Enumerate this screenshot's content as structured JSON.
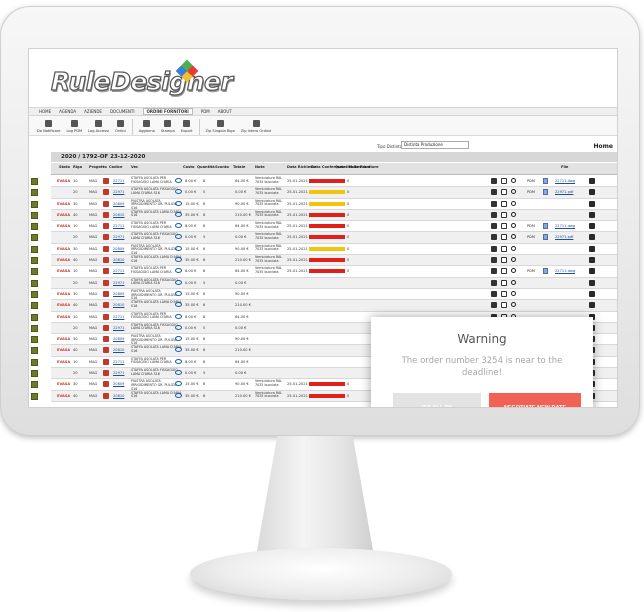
{
  "app": {
    "logo_text": "RuleDesigner",
    "logo_mark": "®"
  },
  "menu": [
    "HOME",
    "AGENDA",
    "AZIENDE",
    "DOCUMENTI",
    "ORDINI FORNITORI",
    "PDM",
    "ABOUT"
  ],
  "menu_active": "ORDINI FORNITORI",
  "toolbar": [
    "Da Notificare",
    "Log PDM",
    "Log Accessi",
    "Ordini",
    "Aggiorna",
    "Stampa",
    "Export",
    "Zip Singola Riga",
    "Zip Intero Ordine"
  ],
  "filter": {
    "label": "Tipo Distinta",
    "value": "Distinta Produzione"
  },
  "home_label": "Home",
  "order_header": "2020  /  1792-OF    23-12-2020",
  "columns": [
    "Stato",
    "Riga",
    "Progetto",
    "Codice",
    "Ver.",
    "Costo",
    "Quantità",
    "Sconto",
    "Totale",
    "Note",
    "Data Richiesta",
    "Data Confermata",
    "Quantità Residua",
    "Note Fornitore",
    "File"
  ],
  "colors": {
    "accent_red": "#f16254",
    "status_red": "#e0201a",
    "status_yellow": "#f1c40f",
    "code_red": "#c0392b"
  },
  "rows": [
    {
      "stato": "EVASA",
      "riga": "10",
      "prog": "MAG",
      "codice": "22711",
      "desc": "STAFFA ASOLATA PER FISSAGGIO LAMA D'ARIA",
      "costo": "8.00 €",
      "qta": "8",
      "totale": "64.00 €",
      "note": "Verniciatura RAL 7035 bucciata",
      "data": "25-01-2021",
      "bar": "red",
      "res": "0",
      "pdm": "PDM",
      "file": "22711.dwg"
    },
    {
      "stato": "",
      "riga": "20",
      "prog": "MAG",
      "codice": "22971",
      "desc": "STAFFA ASOLATA FISSAGGIO LAMA D'ARIA S16",
      "costo": "0.00 €",
      "qta": "5",
      "totale": "0.00 €",
      "note": "Verniciatura RAL 7035 bucciata",
      "data": "25-01-2021",
      "bar": "yellow",
      "res": "0",
      "pdm": "PDM",
      "file": "22971.pdf"
    },
    {
      "stato": "EVASA",
      "riga": "30",
      "prog": "MAG",
      "codice": "20809",
      "desc": "PIASTRA ASOLATA IRRIGIDIMENTO GR. PULIZIA S16",
      "costo": "15.00 €",
      "qta": "6",
      "totale": "90.00 €",
      "note": "Verniciatura RAL 7035 bucciata",
      "data": "25-01-2021",
      "bar": "yellow",
      "res": "0",
      "pdm": "",
      "file": ""
    },
    {
      "stato": "EVASA",
      "riga": "40",
      "prog": "MAG",
      "codice": "20810",
      "desc": "STAFFA ASOLATA LAMA D'ARIA S16",
      "costo": "35.00 €",
      "qta": "6",
      "totale": "210.00 €",
      "note": "Verniciatura RAL 7035 bucciata",
      "data": "25-01-2021",
      "bar": "red",
      "res": "0",
      "pdm": "",
      "file": ""
    },
    {
      "stato": "EVASA",
      "riga": "10",
      "prog": "MAG",
      "codice": "22711",
      "desc": "STAFFA ASOLATA PER FISSAGGIO LAMA D'ARIA",
      "costo": "8.00 €",
      "qta": "8",
      "totale": "64.00 €",
      "note": "Verniciatura RAL 7035 bucciata",
      "data": "25-01-2021",
      "bar": "red",
      "res": "0",
      "pdm": "PDM",
      "file": "22711.dwg"
    },
    {
      "stato": "",
      "riga": "20",
      "prog": "MAG",
      "codice": "22971",
      "desc": "STAFFA ASOLATA FISSAGGIO LAMA D'ARIA S16",
      "costo": "0.00 €",
      "qta": "5",
      "totale": "0.00 €",
      "note": "Verniciatura RAL 7035 bucciata",
      "data": "25-01-2021",
      "bar": "red",
      "res": "0",
      "pdm": "PDM",
      "file": "22971.pdf"
    },
    {
      "stato": "EVASA",
      "riga": "30",
      "prog": "MAG",
      "codice": "20809",
      "desc": "PIASTRA ASOLATA IRRIGIDIMENTO GR. PULIZIA S16",
      "costo": "15.00 €",
      "qta": "6",
      "totale": "90.00 €",
      "note": "Verniciatura RAL 7035 bucciata",
      "data": "25-01-2021",
      "bar": "yellow",
      "res": "0",
      "pdm": "",
      "file": ""
    },
    {
      "stato": "EVASA",
      "riga": "40",
      "prog": "MAG",
      "codice": "20810",
      "desc": "STAFFA ASOLATA LAMA D'ARIA S16",
      "costo": "35.00 €",
      "qta": "6",
      "totale": "210.00 €",
      "note": "Verniciatura RAL 7035 bucciata",
      "data": "25-01-2021",
      "bar": "red",
      "res": "0",
      "pdm": "",
      "file": ""
    },
    {
      "stato": "EVASA",
      "riga": "10",
      "prog": "MAG",
      "codice": "22711",
      "desc": "STAFFA ASOLATA PER FISSAGGIO LAMA D'ARIA",
      "costo": "8.00 €",
      "qta": "8",
      "totale": "64.00 €",
      "note": "Verniciatura RAL 7035 bucciata",
      "data": "25-01-2021",
      "bar": "red",
      "res": "0",
      "pdm": "PDM",
      "file": "22711.dwg"
    },
    {
      "stato": "",
      "riga": "20",
      "prog": "MAG",
      "codice": "22971",
      "desc": "STAFFA ASOLATA FISSAGGIO LAMA D'ARIA S16",
      "costo": "0.00 €",
      "qta": "5",
      "totale": "0.00 €",
      "note": "",
      "data": "",
      "bar": "",
      "res": "",
      "pdm": "",
      "file": ""
    },
    {
      "stato": "EVASA",
      "riga": "30",
      "prog": "MAG",
      "codice": "20809",
      "desc": "PIASTRA ASOLATA IRRIGIDIMENTO GR. PULIZIA S16",
      "costo": "15.00 €",
      "qta": "6",
      "totale": "90.00 €",
      "note": "",
      "data": "",
      "bar": "",
      "res": "",
      "pdm": "",
      "file": ""
    },
    {
      "stato": "EVASA",
      "riga": "40",
      "prog": "MAG",
      "codice": "20810",
      "desc": "STAFFA ASOLATA LAMA D'ARIA S16",
      "costo": "35.00 €",
      "qta": "6",
      "totale": "210.00 €",
      "note": "",
      "data": "",
      "bar": "",
      "res": "",
      "pdm": "",
      "file": ""
    },
    {
      "stato": "EVASA",
      "riga": "10",
      "prog": "MAG",
      "codice": "22711",
      "desc": "STAFFA ASOLATA PER FISSAGGIO LAMA D'ARIA",
      "costo": "8.00 €",
      "qta": "8",
      "totale": "64.00 €",
      "note": "",
      "data": "",
      "bar": "",
      "res": "",
      "pdm": "",
      "file": ""
    },
    {
      "stato": "",
      "riga": "20",
      "prog": "MAG",
      "codice": "22971",
      "desc": "STAFFA ASOLATA FISSAGGIO LAMA D'ARIA S16",
      "costo": "0.00 €",
      "qta": "5",
      "totale": "0.00 €",
      "note": "",
      "data": "",
      "bar": "",
      "res": "",
      "pdm": "",
      "file": ""
    },
    {
      "stato": "EVASA",
      "riga": "30",
      "prog": "MAG",
      "codice": "20809",
      "desc": "PIASTRA ASOLATA IRRIGIDIMENTO GR. PULIZIA S16",
      "costo": "15.00 €",
      "qta": "6",
      "totale": "90.00 €",
      "note": "",
      "data": "",
      "bar": "",
      "res": "",
      "pdm": "",
      "file": ""
    },
    {
      "stato": "EVASA",
      "riga": "40",
      "prog": "MAG",
      "codice": "20810",
      "desc": "STAFFA ASOLATA LAMA D'ARIA S16",
      "costo": "35.00 €",
      "qta": "6",
      "totale": "210.00 €",
      "note": "",
      "data": "",
      "bar": "",
      "res": "",
      "pdm": "",
      "file": ""
    },
    {
      "stato": "EVASA",
      "riga": "10",
      "prog": "MAG",
      "codice": "22711",
      "desc": "STAFFA ASOLATA PER FISSAGGIO LAMA D'ARIA",
      "costo": "8.00 €",
      "qta": "8",
      "totale": "64.00 €",
      "note": "",
      "data": "",
      "bar": "",
      "res": "",
      "pdm": "",
      "file": ""
    },
    {
      "stato": "",
      "riga": "20",
      "prog": "MAG",
      "codice": "22971",
      "desc": "STAFFA ASOLATA FISSAGGIO LAMA D'ARIA S16",
      "costo": "0.00 €",
      "qta": "5",
      "totale": "0.00 €",
      "note": "",
      "data": "",
      "bar": "",
      "res": "",
      "pdm": "",
      "file": ""
    },
    {
      "stato": "EVASA",
      "riga": "30",
      "prog": "MAG",
      "codice": "20809",
      "desc": "PIASTRA ASOLATA IRRIGIDIMENTO GR. PULIZIA S16",
      "costo": "15.00 €",
      "qta": "6",
      "totale": "90.00 €",
      "note": "Verniciatura RAL 7035 bucciata",
      "data": "25-01-2021",
      "bar": "red",
      "res": "0",
      "pdm": "",
      "file": ""
    },
    {
      "stato": "EVASA",
      "riga": "40",
      "prog": "MAG",
      "codice": "20810",
      "desc": "STAFFA ASOLATA LAMA D'ARIA S16",
      "costo": "35.00 €",
      "qta": "6",
      "totale": "210.00 €",
      "note": "Verniciatura RAL 7035 bucciata",
      "data": "25-01-2021",
      "bar": "red",
      "res": "0",
      "pdm": "",
      "file": ""
    }
  ],
  "modal": {
    "title": "Warning",
    "message": "The order number 3254 is near to the deadline!",
    "ok_label": "IT'S ALL OK",
    "negotiate_label": "NEGOTIATE NEW DATE"
  }
}
